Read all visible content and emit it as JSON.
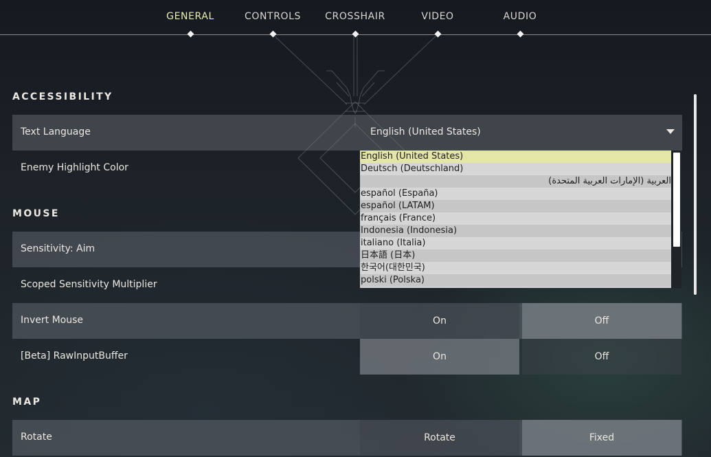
{
  "nav": {
    "tabs": [
      {
        "label": "GENERAL",
        "active": true
      },
      {
        "label": "CONTROLS",
        "active": false
      },
      {
        "label": "CROSSHAIR",
        "active": false
      },
      {
        "label": "VIDEO",
        "active": false
      },
      {
        "label": "AUDIO",
        "active": false
      }
    ]
  },
  "sections": {
    "accessibility": "ACCESSIBILITY",
    "mouse": "MOUSE",
    "map": "MAP"
  },
  "rows": {
    "text_language": {
      "label": "Text Language",
      "value": "English (United States)"
    },
    "enemy_highlight": {
      "label": "Enemy Highlight Color"
    },
    "sensitivity_aim": {
      "label": "Sensitivity: Aim"
    },
    "scoped_sensitivity": {
      "label": "Scoped Sensitivity Multiplier"
    },
    "invert_mouse": {
      "label": "Invert Mouse",
      "option_a": "On",
      "option_b": "Off",
      "selected": "Off"
    },
    "raw_input": {
      "label": "[Beta] RawInputBuffer",
      "option_a": "On",
      "option_b": "Off",
      "selected": "On"
    },
    "rotate": {
      "label": "Rotate",
      "option_a": "Rotate",
      "option_b": "Fixed",
      "selected": "Fixed"
    }
  },
  "language_dropdown": {
    "selected": "English (United States)",
    "options": [
      "English (United States)",
      "Deutsch (Deutschland)",
      "العربية (الإمارات العربية المتحدة)",
      "español (España)",
      "español (LATAM)",
      "français (France)",
      "Indonesia (Indonesia)",
      "italiano (Italia)",
      "日本語 (日本)",
      "한국어(대한민국)",
      "polski (Polska)"
    ]
  },
  "icons": {
    "caret": "chevron-down-icon",
    "tab_marker": "diamond-icon"
  },
  "colors": {
    "active_tab": "#eaeeb2",
    "dropdown_selected": "#e4e6a8",
    "text": "#ece8e1"
  }
}
